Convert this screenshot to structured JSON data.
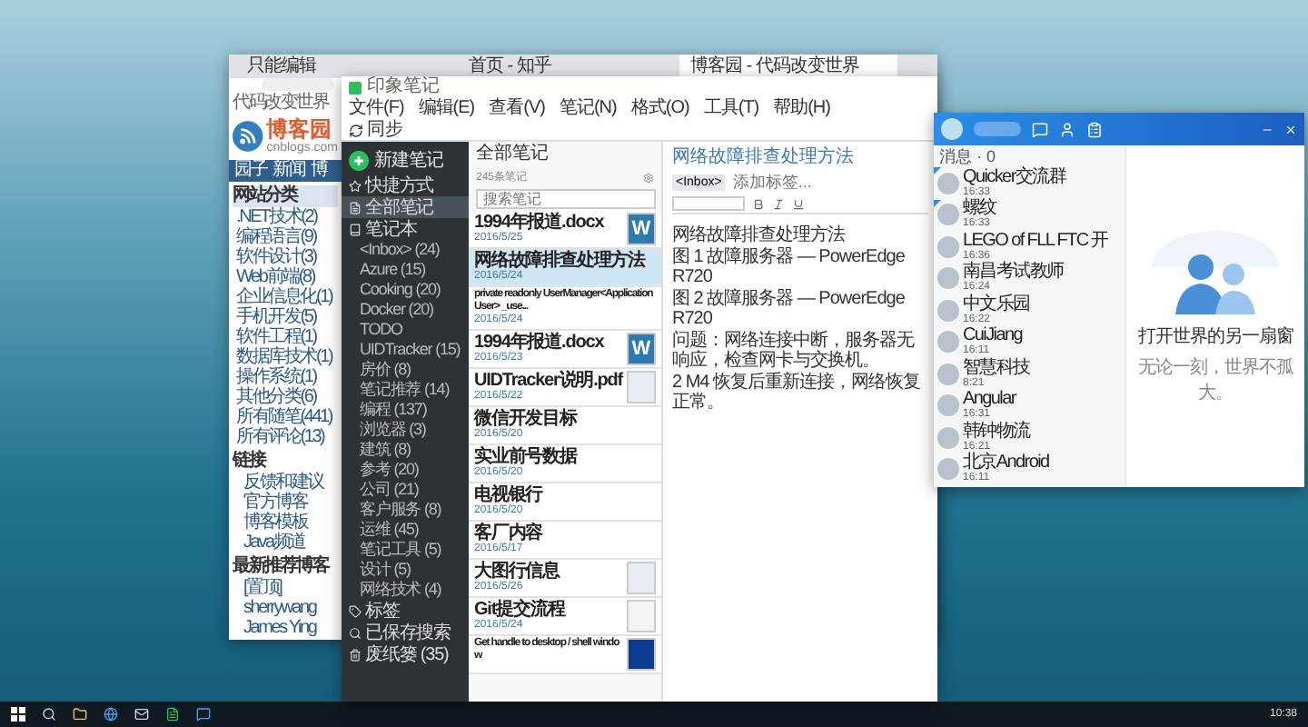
{
  "browser": {
    "tabs": [
      {
        "label": "只能编辑",
        "selected": false
      },
      {
        "label": "首页 - 知乎",
        "selected": false
      },
      {
        "label": "博客园 - 代码改变世界",
        "selected": true
      }
    ],
    "slogan": "代码改变世界",
    "logo": {
      "name": "博客园",
      "domain": "cnblogs.com"
    },
    "nav": [
      "园子",
      "新闻",
      "博"
    ],
    "categories": {
      "title": "网站分类",
      "items": [
        ".NET技术(2)",
        "编程语言(9)",
        "软件设计(3)",
        "Web前端(8)",
        "企业信息化(1)",
        "手机开发(5)",
        "软件工程(1)",
        "数据库技术(1)",
        "操作系统(1)",
        "其他分类(6)",
        "所有随笔(441)",
        "所有评论(13)"
      ]
    },
    "links": {
      "title": "链接",
      "items": [
        "反馈和建议",
        "官方博客",
        "博客模板",
        "Java频道"
      ]
    },
    "recommended": {
      "title": "最新推荐博客",
      "items": [
        "[置顶]",
        "sherrywang",
        "James Ying"
      ]
    }
  },
  "note_window": {
    "title": "印象笔记",
    "menu": [
      "文件(F)",
      "编辑(E)",
      "查看(V)",
      "笔记(N)",
      "格式(O)",
      "工具(T)",
      "帮助(H)"
    ],
    "sync": "同步"
  },
  "sidebar": {
    "new_note": "新建笔记",
    "items": [
      {
        "label": "快捷方式",
        "selected": false
      },
      {
        "label": "全部笔记",
        "selected": true
      },
      {
        "label": "笔记本",
        "selected": false,
        "children": [
          {
            "label": "<Inbox> (24)",
            "selected": false
          },
          {
            "label": "Azure (15)",
            "selected": false
          },
          {
            "label": "Cooking (20)",
            "selected": false
          },
          {
            "label": "Docker (20)",
            "selected": false
          },
          {
            "label": "TODO",
            "selected": false
          },
          {
            "label": "UIDTracker (15)",
            "selected": false
          },
          {
            "label": "房价 (8)",
            "selected": false
          },
          {
            "label": "笔记推荐 (14)",
            "selected": false
          },
          {
            "label": "编程 (137)",
            "selected": false
          },
          {
            "label": "浏览器 (3)",
            "selected": false
          },
          {
            "label": "建筑 (8)",
            "selected": false
          },
          {
            "label": "参考 (20)",
            "selected": false
          },
          {
            "label": "公司 (21)",
            "selected": false
          },
          {
            "label": "客户服务 (8)",
            "selected": false
          },
          {
            "label": "运维 (45)",
            "selected": false
          },
          {
            "label": "笔记工具 (5)",
            "selected": false
          },
          {
            "label": "设计 (5)",
            "selected": false
          },
          {
            "label": "网络技术 (4)",
            "selected": false
          }
        ]
      },
      {
        "label": "标签",
        "selected": false
      },
      {
        "label": "已保存搜索",
        "selected": false
      },
      {
        "label": "废纸篓 (35)",
        "selected": false
      }
    ]
  },
  "notes": {
    "view": "全部笔记",
    "count": "245条笔记",
    "search_placeholder": "搜索笔记",
    "items": [
      {
        "title": "1994年报道.docx",
        "date": "2016/5/25",
        "selected": false,
        "thumb": {
          "kind": "doc",
          "letter": "W"
        }
      },
      {
        "title": "网络故障排查处理方法",
        "date": "2016/5/24",
        "selected": true
      },
      {
        "title": "private readonly UserManager<ApplicationUser> _use...",
        "date": "2016/5/24",
        "selected": false
      },
      {
        "title": "1994年报道.docx",
        "date": "2016/5/23",
        "selected": false,
        "thumb": {
          "kind": "doc",
          "letter": "W"
        }
      },
      {
        "title": "UIDTracker说明.pdf",
        "date": "2016/5/22",
        "selected": false,
        "thumb": {
          "kind": "image"
        }
      },
      {
        "title": "微信开发目标",
        "date": "2016/5/20",
        "selected": false
      },
      {
        "title": "实业前号数据",
        "date": "2016/5/20",
        "selected": false
      },
      {
        "title": "电视银行",
        "date": "2016/5/20",
        "selected": false
      },
      {
        "title": "客厂内容",
        "date": "2016/5/17",
        "selected": false
      },
      {
        "title": "大图行信息",
        "date": "2016/5/26",
        "selected": false,
        "thumb": {
          "kind": "image"
        }
      },
      {
        "title": "Git提交流程",
        "date": "2016/5/24",
        "selected": false,
        "thumb": {
          "kind": "chart"
        }
      },
      {
        "title": "Get handle to desktop / shell window",
        "selected": false,
        "thumb": {
          "kind": "logo"
        }
      }
    ]
  },
  "editor": {
    "title": "网络故障排查处理方法",
    "notebook": "<Inbox>",
    "tag_placeholder": "添加标签...",
    "body": [
      "网络故障排查处理方法",
      "图 1 故障服务器 — PowerEdge R720",
      "图 2 故障服务器 — PowerEdge R720",
      "问题：网络连接中断，服务器无响应，检查网卡与交换机。",
      "2 M4 恢复后重新连接，网络恢复正常。"
    ]
  },
  "chat": {
    "filter": "消息 · 0",
    "contacts": [
      {
        "name": "Quicker交流群",
        "time": "16:33",
        "pinned": true
      },
      {
        "name": "螺纹",
        "time": "16:33",
        "pinned": true
      },
      {
        "name": "LEGO of FLL FTC 开",
        "time": "16:36",
        "pinned": false
      },
      {
        "name": "南昌考试教师",
        "time": "16:24",
        "pinned": false
      },
      {
        "name": "中文乐园",
        "time": "16:22",
        "pinned": false
      },
      {
        "name": "CuiJiang",
        "time": "16:11",
        "pinned": false
      },
      {
        "name": "智慧科技",
        "time": "8:21",
        "pinned": false
      },
      {
        "name": "Angular",
        "time": "16:31",
        "pinned": false
      },
      {
        "name": "韩钟物流",
        "time": "16:21",
        "pinned": false
      },
      {
        "name": "北京Android",
        "time": "16:11",
        "pinned": false
      }
    ],
    "empty": {
      "title": "打开世界的另一扇窗",
      "subtitle": "无论一刻，世界不孤大。"
    }
  },
  "taskbar": {
    "clock": "10:38"
  }
}
